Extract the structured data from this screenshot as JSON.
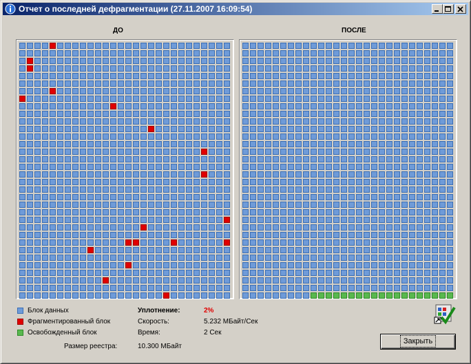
{
  "window": {
    "title": "Отчет о последней дефрагментации (27.11.2007 16:09:54)"
  },
  "panels": {
    "before_label": "ДО",
    "after_label": "ПОСЛЕ",
    "grid": {
      "cols": 28,
      "rows": 34
    },
    "before_fragmented": [
      [
        0,
        4
      ],
      [
        2,
        1
      ],
      [
        3,
        1
      ],
      [
        6,
        4
      ],
      [
        7,
        0
      ],
      [
        8,
        12
      ],
      [
        11,
        17
      ],
      [
        14,
        24
      ],
      [
        17,
        24
      ],
      [
        23,
        27
      ],
      [
        24,
        16
      ],
      [
        26,
        14
      ],
      [
        26,
        15
      ],
      [
        26,
        20
      ],
      [
        26,
        27
      ],
      [
        27,
        9
      ],
      [
        29,
        14
      ],
      [
        31,
        11
      ],
      [
        33,
        19
      ]
    ],
    "after_free_row": 33,
    "after_free_cols": [
      9,
      27
    ]
  },
  "legend": {
    "items": [
      {
        "label": "Блок данных",
        "color": "#6f9bd8"
      },
      {
        "label": "Фрагментированный блок",
        "color": "#e00000"
      },
      {
        "label": "Освобожденный блок",
        "color": "#59b84f"
      }
    ]
  },
  "registry": {
    "label": "Размер реестра:",
    "value": "10.300 МБайт"
  },
  "stats": {
    "compaction_label": "Уплотнение:",
    "compaction_value": "2%",
    "speed_label": "Скорость:",
    "speed_value": "5.232 МБайт/Сек",
    "time_label": "Время:",
    "time_value": "2 Сек"
  },
  "buttons": {
    "close_label": "Закрыть"
  },
  "colors": {
    "title_start": "#0a246a",
    "title_end": "#a6caf0",
    "accent_red": "#e00000"
  }
}
